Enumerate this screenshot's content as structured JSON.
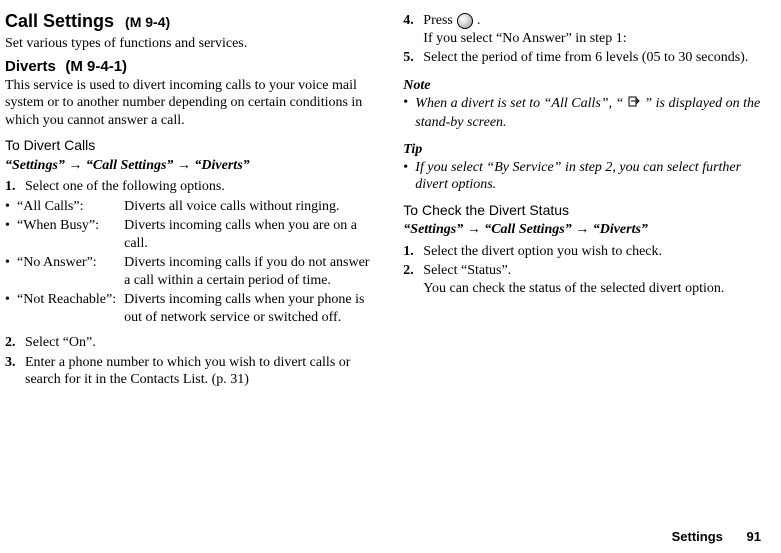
{
  "header": {
    "title": "Call Settings",
    "menucode": "(M 9-4)",
    "subtitle": "Set various types of functions and services."
  },
  "diverts": {
    "heading": "Diverts",
    "menucode": "(M 9-4-1)",
    "intro": "This service is used to divert incoming calls to your voice mail system or to another number depending on certain conditions in which you cannot answer a call.",
    "toDivertHeading": "To Divert Calls",
    "breadcrumb": "“Settings” → “Call Settings” → “Diverts”",
    "step1": "Select one of the following options.",
    "options": [
      {
        "label": "“All Calls”:",
        "desc": "Diverts all voice calls without ringing."
      },
      {
        "label": "“When Busy”:",
        "desc": "Diverts incoming calls when you are on a call."
      },
      {
        "label": "“No Answer”:",
        "desc": "Diverts incoming calls if you do not answer a call within a certain period of time."
      },
      {
        "label": "“Not Reachable”:",
        "desc": "Diverts incoming calls when your phone is out of network service or switched off."
      }
    ],
    "step2": "Select “On”.",
    "step3": "Enter a phone number to which you wish to divert calls or search for it in the Contacts List. (p. 31)",
    "step4_pre": "Press ",
    "step4_post": ".",
    "step4_cond": "If you select “No Answer” in step 1:",
    "step5": "Select the period of time from 6 levels (05 to 30 seconds)."
  },
  "note": {
    "heading": "Note",
    "body_pre": "When a divert is set to “All Calls”, “",
    "body_post": "” is displayed on the stand-by screen."
  },
  "tip": {
    "heading": "Tip",
    "body": "If you select “By Service” in step 2, you can select further divert options."
  },
  "check": {
    "heading": "To Check the Divert Status",
    "breadcrumb": "“Settings” → “Call Settings” → “Diverts”",
    "step1": "Select the divert option you wish to check.",
    "step2": "Select “Status”.",
    "result": "You can check the status of the selected divert option."
  },
  "footer": {
    "section": "Settings",
    "page": "91"
  }
}
